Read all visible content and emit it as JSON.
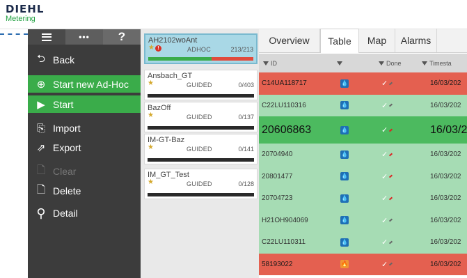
{
  "logo": {
    "title": "DIEHL",
    "subtitle": "Metering"
  },
  "sidebar": {
    "top_tabs": {
      "more": "•••",
      "help": "?"
    },
    "items": [
      {
        "label": "Back",
        "icon": "back-icon"
      },
      {
        "label": "Start new Ad-Hoc",
        "icon": "add-location-icon"
      },
      {
        "label": "Start",
        "icon": "play-icon"
      },
      {
        "label": "Import",
        "icon": "import-icon"
      },
      {
        "label": "Export",
        "icon": "export-icon"
      },
      {
        "label": "Clear",
        "icon": "clear-icon"
      },
      {
        "label": "Delete",
        "icon": "delete-icon"
      },
      {
        "label": "Detail",
        "icon": "search-icon"
      }
    ]
  },
  "routes": [
    {
      "name": "AH2102woAnt",
      "type": "ADHOC",
      "count": "213/213",
      "progress": 1.0,
      "selected": true
    },
    {
      "name": "Ansbach_GT",
      "type": "GUIDED",
      "count": "0/403",
      "progress": 0
    },
    {
      "name": "BazOff",
      "type": "GUIDED",
      "count": "0/137",
      "progress": 0
    },
    {
      "name": "IM-GT-Baz",
      "type": "GUIDED",
      "count": "0/141",
      "progress": 0
    },
    {
      "name": "IM_GT_Test",
      "type": "GUIDED",
      "count": "0/128",
      "progress": 0
    }
  ],
  "tabs": [
    "Overview",
    "Table",
    "Map",
    "Alarms"
  ],
  "table": {
    "columns": [
      "ID",
      "",
      "Done",
      "Timesta"
    ],
    "rows": [
      {
        "id": "C14UA118717",
        "timestamp": "16/03/202",
        "status": "red"
      },
      {
        "id": "C22LU110316",
        "timestamp": "16/03/202",
        "status": "green"
      },
      {
        "id": "20606863",
        "timestamp": "16/03/2",
        "status": "big"
      },
      {
        "id": "20704940",
        "timestamp": "16/03/202",
        "status": "green"
      },
      {
        "id": "20801477",
        "timestamp": "16/03/202",
        "status": "green"
      },
      {
        "id": "20704723",
        "timestamp": "16/03/202",
        "status": "green"
      },
      {
        "id": "H21OH904069",
        "timestamp": "16/03/202",
        "status": "green"
      },
      {
        "id": "C22LU110311",
        "timestamp": "16/03/202",
        "status": "green"
      },
      {
        "id": "58193022",
        "timestamp": "16/03/202",
        "status": "red"
      }
    ]
  },
  "colors": {
    "green": "#3aac4a",
    "red": "#e46050",
    "light_green": "#a6dcb4",
    "selected_blue": "#a9d8e6",
    "sidebar": "#3c3c3c"
  }
}
